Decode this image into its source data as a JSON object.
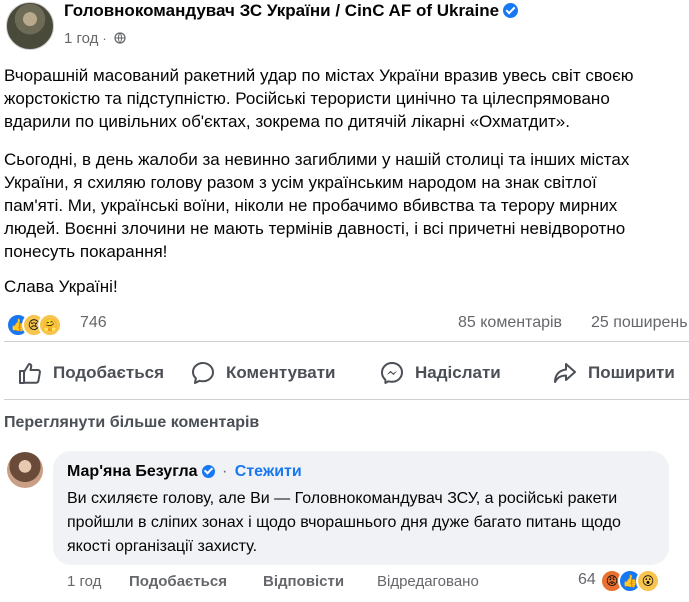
{
  "post": {
    "author": "Головнокомандувач ЗС України / CinC AF of Ukraine",
    "time": "1 год",
    "audience_icon": "globe-icon",
    "paragraphs": [
      "Вчорашній масований ракетний удар по містах України вразив увесь світ своєю\nжорстокістю та підступністю. Російські терористи цинічно та цілеспрямовано\nвдарили по цивільних об'єктах, зокрема по дитячій лікарні «Охматдит».",
      "Сьогодні, в день жалоби за невинно загиблими у нашій столиці та інших містах\nУкраїни, я схиляю голову разом з усім українським народом на знак світлої\nпам'яті. Ми, українські воїни, ніколи не пробачимо вбивства та терору мирних\nлюдей. Воєнні злочини не мають термінів давності, і всі причетні невідворотно\nпонесуть покарання!",
      "Слава Україні!"
    ],
    "reactions": {
      "count": "746",
      "icons": [
        "like-icon",
        "sad-icon",
        "care-icon"
      ]
    },
    "comments_count": "85 коментарів",
    "shares_count": "25 поширень"
  },
  "actions": {
    "like": "Подобається",
    "comment": "Коментувати",
    "send": "Надіслати",
    "share": "Поширити"
  },
  "comments_section": {
    "view_more": "Переглянути більше коментарів",
    "comment": {
      "author": "Мар'яна Безугла",
      "follow": "Стежити",
      "text": "Ви схиляєте голову, але Ви — Головнокомандувач ЗСУ, а російські ракети пройшли в сліпих зонах і щодо вчорашнього дня дуже багато питань щодо якості організації захисту.",
      "time": "1 год",
      "like": "Подобається",
      "reply": "Відповісти",
      "edited": "Відредаговано",
      "reactions_count": "64",
      "reaction_icons": [
        "angry-icon",
        "like-icon",
        "wow-icon"
      ]
    }
  },
  "colors": {
    "brand": "#1877f2",
    "secondary_text": "#65676b",
    "bubble": "#f0f2f5"
  }
}
